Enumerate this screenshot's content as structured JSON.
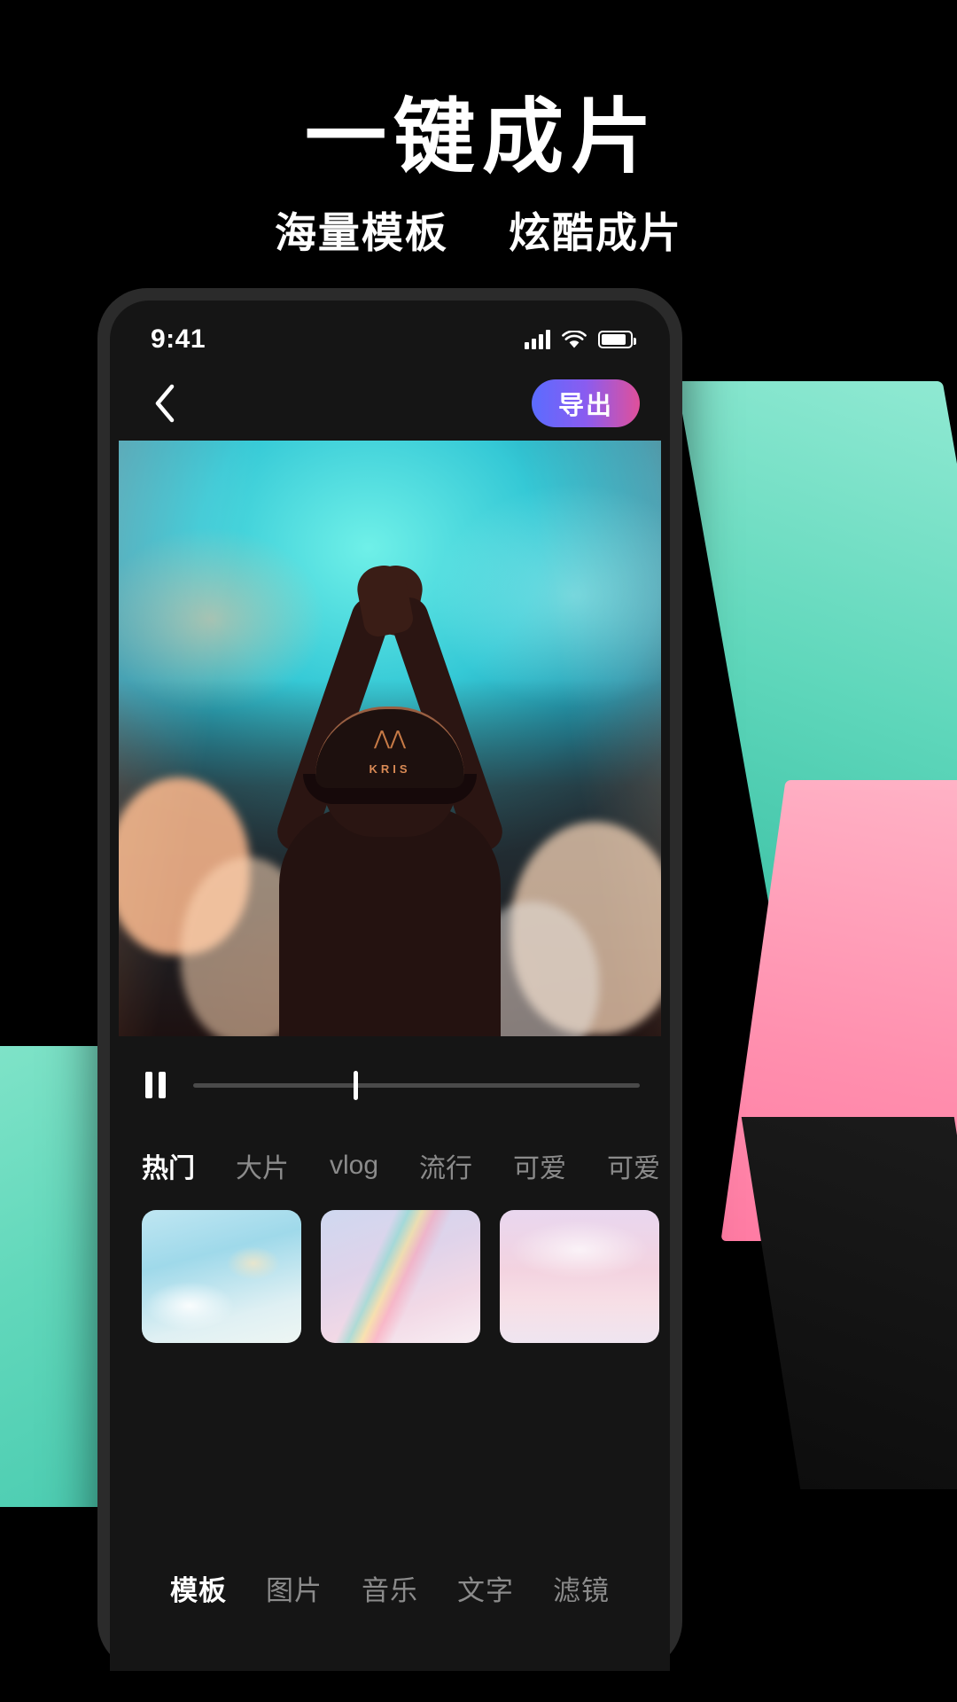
{
  "hero": {
    "title": "一键成片",
    "subtitle_left": "海量模板",
    "subtitle_right": "炫酷成片"
  },
  "colors": {
    "accent_teal": "#62d8bb",
    "accent_pink": "#ff8fae",
    "export_gradient_start": "#5b6cff",
    "export_gradient_mid": "#8a5cf0",
    "export_gradient_end": "#e0509a",
    "screen_bg": "#151515",
    "inactive_text": "#8b8b8b",
    "active_text": "#ffffff"
  },
  "statusbar": {
    "time": "9:41",
    "signal_icon": "signal-bars-icon",
    "wifi_icon": "wifi-icon",
    "battery_icon": "battery-icon"
  },
  "navbar": {
    "back_icon": "back-chevron-icon",
    "export_label": "导出"
  },
  "preview": {
    "cap_logo": "wings-logo-icon",
    "cap_brand": "KRIS"
  },
  "playback": {
    "pause_icon": "pause-icon",
    "progress_percent": 36
  },
  "categories": [
    {
      "label": "热门",
      "active": true
    },
    {
      "label": "大片",
      "active": false
    },
    {
      "label": "vlog",
      "active": false
    },
    {
      "label": "流行",
      "active": false
    },
    {
      "label": "可爱",
      "active": false
    },
    {
      "label": "可爱",
      "active": false
    }
  ],
  "templates": [
    {
      "name": "template-thumb-1"
    },
    {
      "name": "template-thumb-2"
    },
    {
      "name": "template-thumb-3"
    },
    {
      "name": "template-thumb-4"
    }
  ],
  "bottom_nav": [
    {
      "label": "模板",
      "active": true
    },
    {
      "label": "图片",
      "active": false
    },
    {
      "label": "音乐",
      "active": false
    },
    {
      "label": "文字",
      "active": false
    },
    {
      "label": "滤镜",
      "active": false
    }
  ]
}
